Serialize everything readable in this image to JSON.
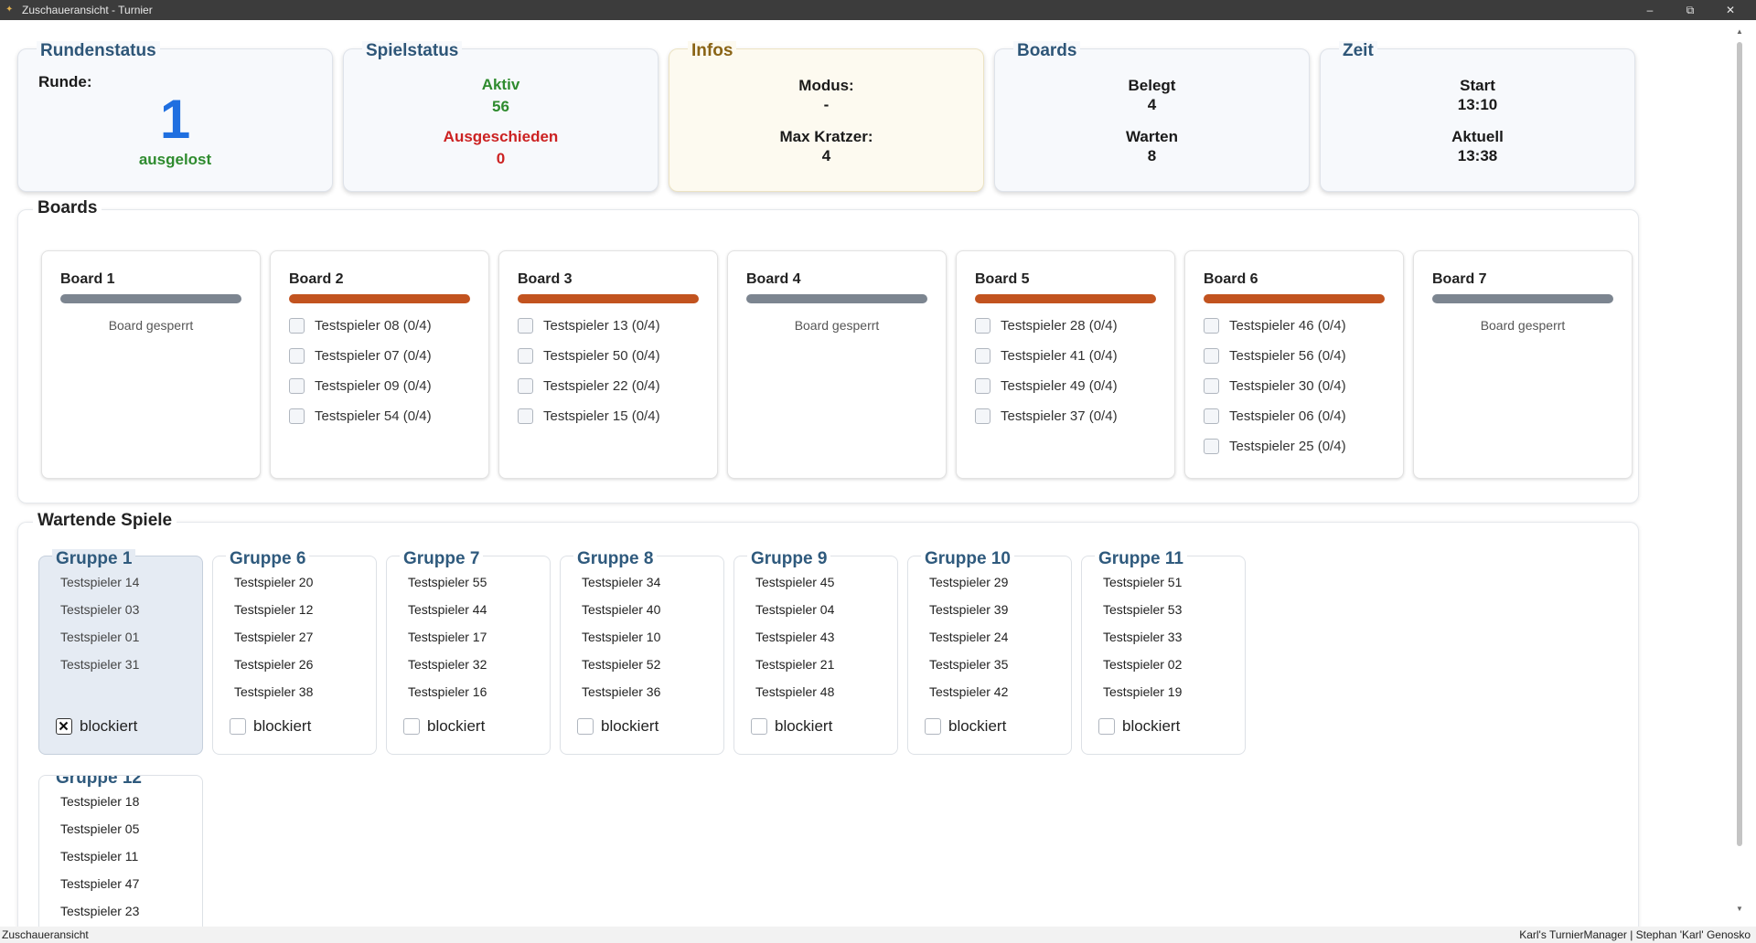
{
  "window": {
    "title": "Zuschaueransicht - Turnier",
    "controls": {
      "minimize": "–",
      "maximize": "⧉",
      "close": "✕"
    }
  },
  "cards": {
    "rundenstatus": {
      "title": "Rundenstatus",
      "label": "Runde:",
      "round": "1",
      "state": "ausgelost"
    },
    "spielstatus": {
      "title": "Spielstatus",
      "active_label": "Aktiv",
      "active_count": "56",
      "out_label": "Ausgeschieden",
      "out_count": "0"
    },
    "infos": {
      "title": "Infos",
      "mode_label": "Modus:",
      "mode_value": "-",
      "kratzer_label": "Max Kratzer:",
      "kratzer_value": "4"
    },
    "boards": {
      "title": "Boards",
      "occupied_label": "Belegt",
      "occupied_value": "4",
      "waiting_label": "Warten",
      "waiting_value": "8"
    },
    "zeit": {
      "title": "Zeit",
      "start_label": "Start",
      "start_value": "13:10",
      "current_label": "Aktuell",
      "current_value": "13:38"
    }
  },
  "boards_section": {
    "title": "Boards",
    "boards": [
      {
        "name": "Board 1",
        "status": "free",
        "locked_text": "Board gesperrt",
        "players": []
      },
      {
        "name": "Board 2",
        "status": "busy",
        "players": [
          "Testspieler 08 (0/4)",
          "Testspieler 07 (0/4)",
          "Testspieler 09 (0/4)",
          "Testspieler 54 (0/4)"
        ]
      },
      {
        "name": "Board 3",
        "status": "busy",
        "players": [
          "Testspieler 13 (0/4)",
          "Testspieler 50 (0/4)",
          "Testspieler 22 (0/4)",
          "Testspieler 15 (0/4)"
        ]
      },
      {
        "name": "Board 4",
        "status": "free",
        "locked_text": "Board gesperrt",
        "players": []
      },
      {
        "name": "Board 5",
        "status": "busy",
        "players": [
          "Testspieler 28 (0/4)",
          "Testspieler 41 (0/4)",
          "Testspieler 49 (0/4)",
          "Testspieler 37 (0/4)"
        ]
      },
      {
        "name": "Board 6",
        "status": "busy",
        "players": [
          "Testspieler 46 (0/4)",
          "Testspieler 56 (0/4)",
          "Testspieler 30 (0/4)",
          "Testspieler 06 (0/4)",
          "Testspieler 25 (0/4)"
        ]
      },
      {
        "name": "Board 7",
        "status": "free",
        "locked_text": "Board gesperrt",
        "players": []
      }
    ]
  },
  "waiting_section": {
    "title": "Wartende Spiele",
    "blocked_label": "blockiert",
    "groups": [
      {
        "name": "Gruppe 1",
        "selected": true,
        "blocked": true,
        "players": [
          "Testspieler 14",
          "Testspieler 03",
          "Testspieler 01",
          "Testspieler 31"
        ]
      },
      {
        "name": "Gruppe 6",
        "selected": false,
        "blocked": false,
        "players": [
          "Testspieler 20",
          "Testspieler 12",
          "Testspieler 27",
          "Testspieler 26",
          "Testspieler 38"
        ]
      },
      {
        "name": "Gruppe 7",
        "selected": false,
        "blocked": false,
        "players": [
          "Testspieler 55",
          "Testspieler 44",
          "Testspieler 17",
          "Testspieler 32",
          "Testspieler 16"
        ]
      },
      {
        "name": "Gruppe 8",
        "selected": false,
        "blocked": false,
        "players": [
          "Testspieler 34",
          "Testspieler 40",
          "Testspieler 10",
          "Testspieler 52",
          "Testspieler 36"
        ]
      },
      {
        "name": "Gruppe 9",
        "selected": false,
        "blocked": false,
        "players": [
          "Testspieler 45",
          "Testspieler 04",
          "Testspieler 43",
          "Testspieler 21",
          "Testspieler 48"
        ]
      },
      {
        "name": "Gruppe 10",
        "selected": false,
        "blocked": false,
        "players": [
          "Testspieler 29",
          "Testspieler 39",
          "Testspieler 24",
          "Testspieler 35",
          "Testspieler 42"
        ]
      },
      {
        "name": "Gruppe 11",
        "selected": false,
        "blocked": false,
        "players": [
          "Testspieler 51",
          "Testspieler 53",
          "Testspieler 33",
          "Testspieler 02",
          "Testspieler 19"
        ]
      },
      {
        "name": "Gruppe 12",
        "selected": false,
        "blocked": false,
        "players": [
          "Testspieler 18",
          "Testspieler 05",
          "Testspieler 11",
          "Testspieler 47",
          "Testspieler 23"
        ]
      }
    ]
  },
  "statusbar": {
    "left": "Zuschaueransicht",
    "right": "Karl's TurnierManager | Stephan 'Karl' Genosko"
  },
  "colors": {
    "busy": "#c2531f",
    "free": "#7c8590",
    "active": "#2e8b2e",
    "out": "#cc2222",
    "round": "#1f6fe0"
  }
}
